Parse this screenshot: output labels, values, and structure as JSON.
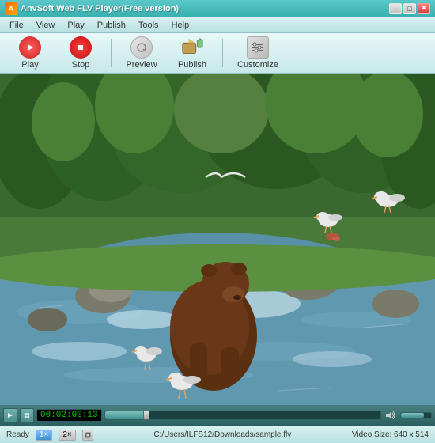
{
  "app": {
    "title": "AnvSoft Web FLV Player(Free version)",
    "icon": "A"
  },
  "window_controls": {
    "minimize": "─",
    "maximize": "□",
    "close": "✕"
  },
  "menu": {
    "items": [
      "File",
      "View",
      "Play",
      "Publish",
      "Tools",
      "Help"
    ]
  },
  "toolbar": {
    "play_label": "Play",
    "stop_label": "Stop",
    "preview_label": "Preview",
    "publish_label": "Publish",
    "customize_label": "Customize"
  },
  "player": {
    "time_display": "00:02:00:13",
    "progress_percent": 15,
    "volume_percent": 75
  },
  "status": {
    "ready_text": "Ready",
    "file_path": "C:/Users/ILFS12/Downloads/sample.flv",
    "video_size": "Video Size: 640 x 514",
    "zoom_1x": "1×",
    "zoom_2x": "2×"
  }
}
